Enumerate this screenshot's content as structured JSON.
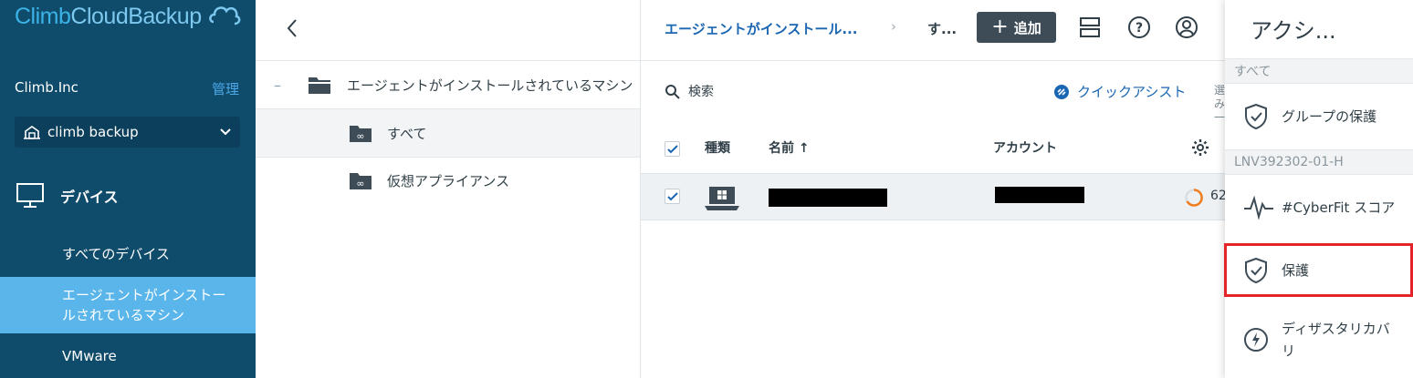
{
  "sidebar": {
    "logo_part1": "Climb",
    "logo_part2": "CloudBackup",
    "tenant_name": "Climb.Inc",
    "manage_label": "管理",
    "unit_selector": {
      "value": "climb backup",
      "icon": "building-icon"
    },
    "nav_devices": {
      "label": "デバイス",
      "icon": "monitor-icon"
    },
    "subitems": [
      {
        "label": "すべてのデバイス",
        "active": false
      },
      {
        "label": "エージェントがインストールされているマシン",
        "active": true
      },
      {
        "label": "VMware",
        "active": false
      }
    ]
  },
  "tree": {
    "root": {
      "label": "エージェントがインストールされているマシン",
      "toggle": "–",
      "icon": "folder-icon"
    },
    "children": [
      {
        "label": "すべて",
        "icon": "dynamic-group-icon",
        "selected": true
      },
      {
        "label": "仮想アプライアンス",
        "icon": "dynamic-group-icon",
        "selected": false
      }
    ]
  },
  "main": {
    "breadcrumb": {
      "item1": "エージェントがインストール...",
      "separator": "›",
      "item2": "す..."
    },
    "add_button": {
      "label": "追加",
      "plus": "+"
    },
    "search": {
      "placeholder": "検索"
    },
    "quick_assist": "クイックアシスト",
    "cutoff_text": "選み一",
    "table": {
      "headers": {
        "type": "種類",
        "name": "名前 ↑",
        "account": "アカウント"
      },
      "rows": [
        {
          "checked": true,
          "type_icon": "windows-laptop-icon",
          "name": "",
          "account": "",
          "status_value": "62"
        }
      ]
    }
  },
  "actions": {
    "title": "アクシ...",
    "sections": [
      {
        "label": "すべて",
        "items": [
          {
            "label": "グループの保護",
            "icon": "shield-check-icon"
          }
        ]
      },
      {
        "label": "LNV392302-01-H",
        "items": [
          {
            "label": "#CyberFit スコア",
            "icon": "pulse-icon"
          },
          {
            "label": "保護",
            "icon": "shield-check-icon",
            "highlighted": true
          },
          {
            "label": "ディザスタリカバリ",
            "icon": "lightning-icon"
          }
        ]
      }
    ]
  },
  "colors": {
    "sidebar_bg": "#0f4b6b",
    "sidebar_active": "#5ab6ea",
    "link_blue": "#1a66b3",
    "highlight_red": "#e3242b",
    "status_orange": "#f07d1f"
  }
}
